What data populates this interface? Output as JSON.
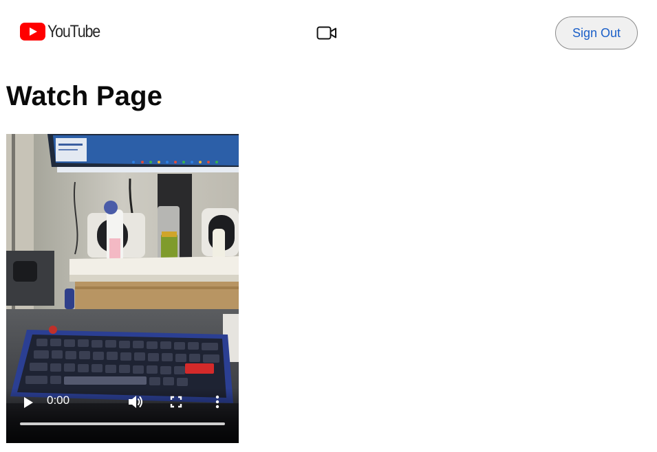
{
  "header": {
    "logo_icon": "youtube-play-icon",
    "logo_text": "YouTube",
    "upload_icon": "video-camera-icon",
    "sign_out_label": "Sign Out"
  },
  "main": {
    "page_title": "Watch Page"
  },
  "video": {
    "current_time": "0:00",
    "progress": 0,
    "controls": {
      "play_icon": "play-icon",
      "volume_icon": "volume-icon",
      "fullscreen_icon": "fullscreen-icon",
      "more_icon": "more-options-icon"
    }
  },
  "colors": {
    "brand_red": "#ff0000",
    "link_blue": "#1a5fc8"
  }
}
